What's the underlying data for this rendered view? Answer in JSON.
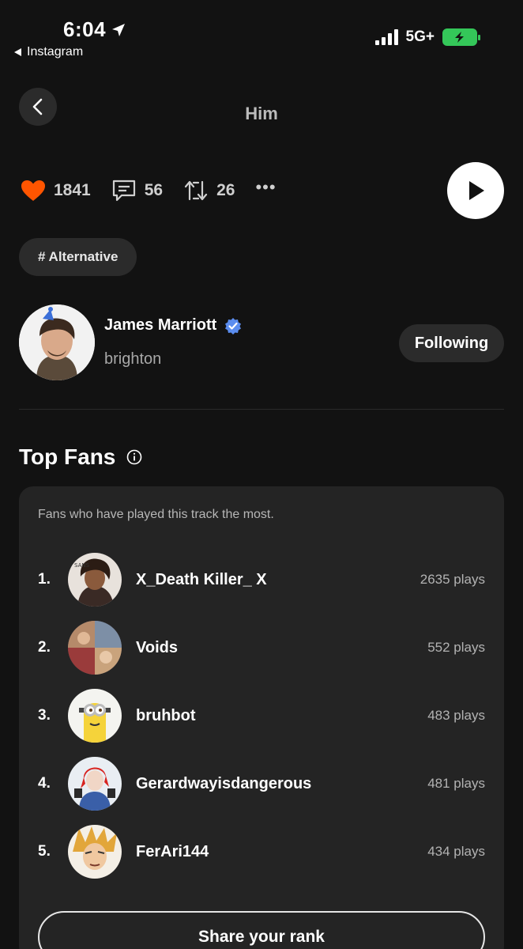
{
  "status_bar": {
    "time": "6:04",
    "back_app": "Instagram",
    "network": "5G+",
    "location_icon": "location-arrow-icon",
    "battery_color": "#34c759"
  },
  "header": {
    "title": "Him"
  },
  "actions": {
    "likes": "1841",
    "comments": "56",
    "reposts": "26",
    "like_color": "#ff5500"
  },
  "genre": "# Alternative",
  "artist": {
    "name": "James Marriott",
    "handle": "brighton",
    "verified": true,
    "verified_color": "#5b8def",
    "follow_label": "Following"
  },
  "top_fans": {
    "title": "Top Fans",
    "description": "Fans who have played this track the most.",
    "fans": [
      {
        "rank": "1.",
        "name": "X_Death Killer_ X",
        "plays": "2635 plays"
      },
      {
        "rank": "2.",
        "name": "Voids",
        "plays": "552 plays"
      },
      {
        "rank": "3.",
        "name": "bruhbot",
        "plays": "483 plays"
      },
      {
        "rank": "4.",
        "name": "Gerardwayisdangerous",
        "plays": "481 plays"
      },
      {
        "rank": "5.",
        "name": "FerAri144",
        "plays": "434 plays"
      }
    ],
    "share_label": "Share your rank"
  }
}
